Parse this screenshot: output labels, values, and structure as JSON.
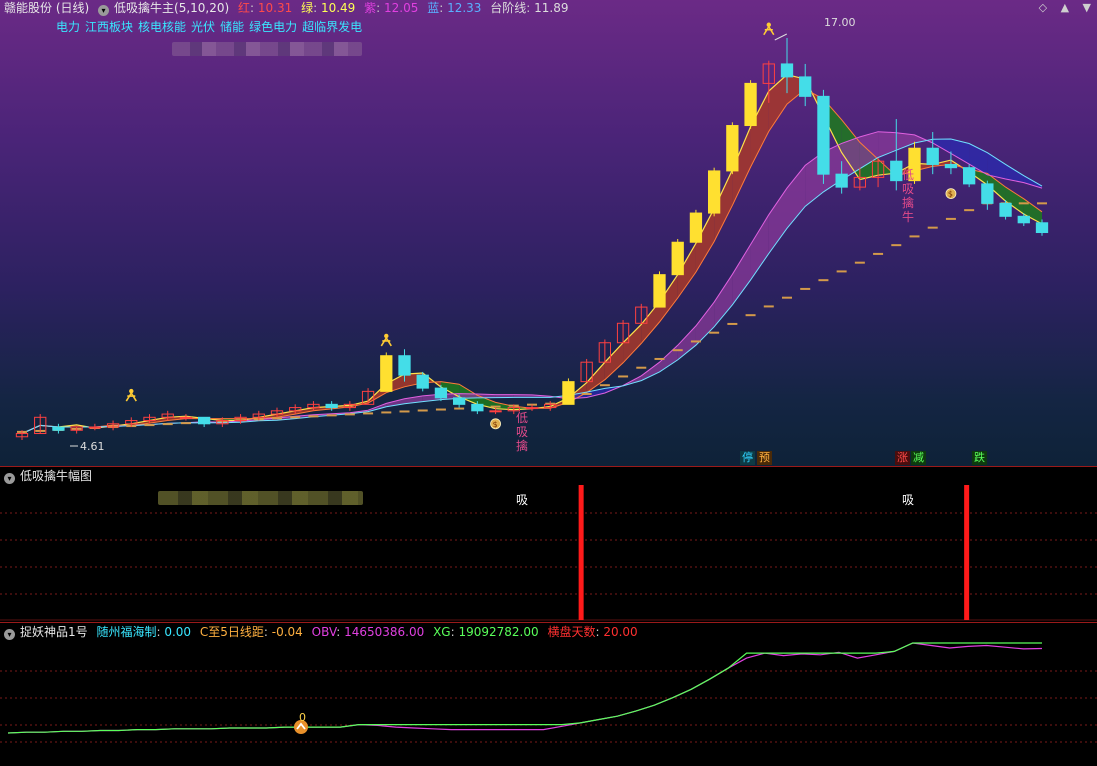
{
  "main": {
    "stock": "赣能股份 (日线)",
    "indicator": "低吸擒牛主(5,10,20)",
    "values": [
      {
        "label": "红",
        "value": "10.31",
        "color": "#ff4a4a"
      },
      {
        "label": "绿",
        "value": "10.49",
        "color": "#ffff55"
      },
      {
        "label": "紫",
        "value": "12.05",
        "color": "#e040e0"
      },
      {
        "label": "蓝",
        "value": "12.33",
        "color": "#5ab0ff"
      },
      {
        "label": "台阶线",
        "value": "11.89",
        "color": "#dddddd"
      }
    ],
    "sectors": [
      "电力",
      "江西板块",
      "核电核能",
      "光伏",
      "储能",
      "绿色电力",
      "超临界发电"
    ],
    "peak_label": "17.00",
    "low_label": "4.61",
    "signal_text_1": [
      "低",
      "吸",
      "擒"
    ],
    "signal_text_2": [
      "低",
      "吸",
      "擒",
      "牛"
    ],
    "bottom_tags": [
      {
        "text": "停",
        "color": "#2fd3ff",
        "bg": "#0d3a44"
      },
      {
        "text": "预",
        "color": "#ffb040",
        "bg": "#4a2a08"
      },
      {
        "text": "涨",
        "color": "#ff4a4a",
        "bg": "#4a0e0e"
      },
      {
        "text": "减",
        "color": "#5aff5a",
        "bg": "#0e3a0e"
      },
      {
        "text": "跌",
        "color": "#5aff5a",
        "bg": "#0e3a0e"
      }
    ],
    "icons": [
      "collapse-icon",
      "diamond-icon",
      "up-arrow-icon",
      "down-arrow-icon"
    ]
  },
  "amplitude": {
    "title": "低吸擒牛幅图",
    "signal_label": "吸"
  },
  "bottom": {
    "title": "捉妖神品1号",
    "values": [
      {
        "label": "随州福海制",
        "value": "0.00",
        "color": "#39e6ff"
      },
      {
        "label": "C至5日线距",
        "value": "-0.04",
        "color": "#ffb040"
      },
      {
        "label": "OBV",
        "value": "14650386.00",
        "color": "#e040e0"
      },
      {
        "label": "XG",
        "value": "19092782.00",
        "color": "#5aff5a"
      },
      {
        "label": "横盘天数",
        "value": "20.00",
        "color": "#ff3030"
      }
    ],
    "marker_label": "0"
  },
  "chart_data": [
    {
      "type": "candlestick",
      "title": "赣能股份 (日线)",
      "ohlc_approx": [
        [
          4.7,
          4.9,
          4.6,
          4.8
        ],
        [
          4.8,
          5.4,
          4.8,
          5.3
        ],
        [
          5.0,
          5.1,
          4.8,
          4.9
        ],
        [
          4.9,
          5.0,
          4.8,
          5.0
        ],
        [
          5.0,
          5.1,
          4.9,
          5.0
        ],
        [
          5.0,
          5.2,
          4.9,
          5.1
        ],
        [
          5.1,
          5.3,
          5.0,
          5.2
        ],
        [
          5.2,
          5.4,
          5.1,
          5.3
        ],
        [
          5.3,
          5.5,
          5.2,
          5.4
        ],
        [
          5.3,
          5.4,
          5.2,
          5.3
        ],
        [
          5.3,
          5.3,
          5.0,
          5.1
        ],
        [
          5.1,
          5.3,
          5.0,
          5.2
        ],
        [
          5.2,
          5.4,
          5.1,
          5.3
        ],
        [
          5.3,
          5.5,
          5.2,
          5.4
        ],
        [
          5.4,
          5.6,
          5.3,
          5.5
        ],
        [
          5.5,
          5.7,
          5.4,
          5.6
        ],
        [
          5.6,
          5.8,
          5.5,
          5.7
        ],
        [
          5.7,
          5.8,
          5.5,
          5.6
        ],
        [
          5.6,
          5.8,
          5.5,
          5.7
        ],
        [
          5.7,
          6.2,
          5.7,
          6.1
        ],
        [
          6.1,
          7.3,
          6.1,
          7.2
        ],
        [
          7.2,
          7.4,
          6.4,
          6.6
        ],
        [
          6.6,
          6.7,
          6.1,
          6.2
        ],
        [
          6.2,
          6.3,
          5.8,
          5.9
        ],
        [
          5.9,
          6.0,
          5.6,
          5.7
        ],
        [
          5.7,
          5.8,
          5.4,
          5.5
        ],
        [
          5.5,
          5.6,
          5.4,
          5.5
        ],
        [
          5.5,
          5.7,
          5.4,
          5.6
        ],
        [
          5.6,
          5.7,
          5.5,
          5.6
        ],
        [
          5.6,
          5.8,
          5.5,
          5.7
        ],
        [
          5.7,
          6.5,
          5.7,
          6.4
        ],
        [
          6.4,
          7.1,
          6.4,
          7.0
        ],
        [
          7.0,
          7.7,
          7.0,
          7.6
        ],
        [
          7.6,
          8.3,
          7.6,
          8.2
        ],
        [
          8.2,
          8.8,
          8.2,
          8.7
        ],
        [
          8.7,
          9.8,
          8.7,
          9.7
        ],
        [
          9.7,
          10.8,
          9.7,
          10.7
        ],
        [
          10.7,
          11.7,
          10.7,
          11.6
        ],
        [
          11.6,
          13.0,
          11.5,
          12.9
        ],
        [
          12.9,
          14.4,
          12.8,
          14.3
        ],
        [
          14.3,
          15.7,
          14.2,
          15.6
        ],
        [
          15.6,
          16.3,
          15.0,
          16.2
        ],
        [
          16.2,
          17.0,
          15.3,
          15.8
        ],
        [
          15.8,
          16.2,
          14.9,
          15.2
        ],
        [
          15.2,
          15.4,
          12.5,
          12.8
        ],
        [
          12.8,
          13.2,
          12.2,
          12.4
        ],
        [
          12.4,
          13.0,
          12.3,
          12.7
        ],
        [
          12.7,
          13.3,
          12.4,
          13.2
        ],
        [
          13.2,
          14.5,
          12.3,
          12.6
        ],
        [
          12.6,
          13.8,
          12.5,
          13.6
        ],
        [
          13.6,
          14.1,
          12.8,
          13.1
        ],
        [
          13.1,
          13.5,
          12.8,
          13.0
        ],
        [
          13.0,
          13.1,
          12.4,
          12.5
        ],
        [
          12.5,
          12.6,
          11.7,
          11.9
        ],
        [
          11.9,
          12.0,
          11.4,
          11.5
        ],
        [
          11.5,
          11.6,
          11.2,
          11.3
        ],
        [
          11.3,
          11.4,
          10.9,
          11.0
        ]
      ],
      "price_range": [
        4.6,
        17.0
      ],
      "series": [
        {
          "name": "红",
          "last": 10.31
        },
        {
          "name": "绿",
          "last": 10.49
        },
        {
          "name": "紫",
          "last": 12.05
        },
        {
          "name": "蓝",
          "last": 12.33
        },
        {
          "name": "台阶线",
          "last": 11.89
        }
      ],
      "annotations": [
        "17.00",
        "4.61"
      ]
    },
    {
      "type": "bar",
      "title": "低吸擒牛幅图",
      "signals": [
        31,
        52
      ],
      "signal_label": "吸"
    },
    {
      "type": "line",
      "title": "捉妖神品1号",
      "series": [
        {
          "name": "OBV",
          "values": [
            4.6,
            4.7,
            4.7,
            4.8,
            4.8,
            4.9,
            4.9,
            5.0,
            5.0,
            5.1,
            5.1,
            5.1,
            5.2,
            5.2,
            5.2,
            5.3,
            5.3,
            5.3,
            5.3,
            5.6,
            5.5,
            5.3,
            5.2,
            5.1,
            5.0,
            5.0,
            5.0,
            5.0,
            5.0,
            5.0,
            5.4,
            5.8,
            6.2,
            6.6,
            7.2,
            7.9,
            8.8,
            9.8,
            11.0,
            12.3,
            13.5,
            14.1,
            13.8,
            14.0,
            13.9,
            14.2,
            13.5,
            13.9,
            14.3,
            15.3,
            15.0,
            14.7,
            14.9,
            15.0,
            14.8,
            14.6,
            14.65
          ]
        },
        {
          "name": "XG",
          "values": [
            4.6,
            4.7,
            4.7,
            4.8,
            4.8,
            4.9,
            4.9,
            5.0,
            5.0,
            5.1,
            5.1,
            5.1,
            5.2,
            5.2,
            5.2,
            5.3,
            5.3,
            5.3,
            5.3,
            5.6,
            5.6,
            5.6,
            5.6,
            5.6,
            5.6,
            5.6,
            5.6,
            5.6,
            5.6,
            5.6,
            5.6,
            5.8,
            6.2,
            6.6,
            7.2,
            7.9,
            8.8,
            9.8,
            11.0,
            12.3,
            14.1,
            14.1,
            14.1,
            14.1,
            14.1,
            14.1,
            14.1,
            14.1,
            14.3,
            15.3,
            15.3,
            15.3,
            15.3,
            15.3,
            15.3,
            15.3,
            15.3
          ]
        }
      ]
    }
  ]
}
